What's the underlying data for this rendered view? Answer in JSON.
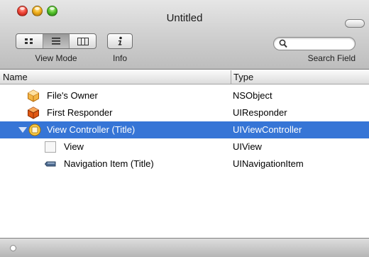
{
  "window": {
    "title": "Untitled"
  },
  "toolbar": {
    "view_mode_label": "View Mode",
    "view_modes": [
      "icon",
      "list",
      "column"
    ],
    "view_mode_selected": "list",
    "info_label": "Info",
    "search_label": "Search Field",
    "search_value": ""
  },
  "columns": {
    "name": "Name",
    "type": "Type"
  },
  "rows": [
    {
      "name": "File's Owner",
      "type": "NSObject",
      "icon": "cube-icon",
      "depth": 0
    },
    {
      "name": "First Responder",
      "type": "UIResponder",
      "icon": "first-responder-icon",
      "depth": 0
    },
    {
      "name": "View Controller (Title)",
      "type": "UIViewController",
      "icon": "view-controller-icon",
      "depth": 0,
      "selected": true,
      "expanded": true
    },
    {
      "name": "View",
      "type": "UIView",
      "icon": "view-icon",
      "depth": 1
    },
    {
      "name": "Navigation Item (Title)",
      "type": "UINavigationItem",
      "icon": "navigation-item-icon",
      "depth": 1
    }
  ],
  "colors": {
    "selection": "#3675d6"
  }
}
